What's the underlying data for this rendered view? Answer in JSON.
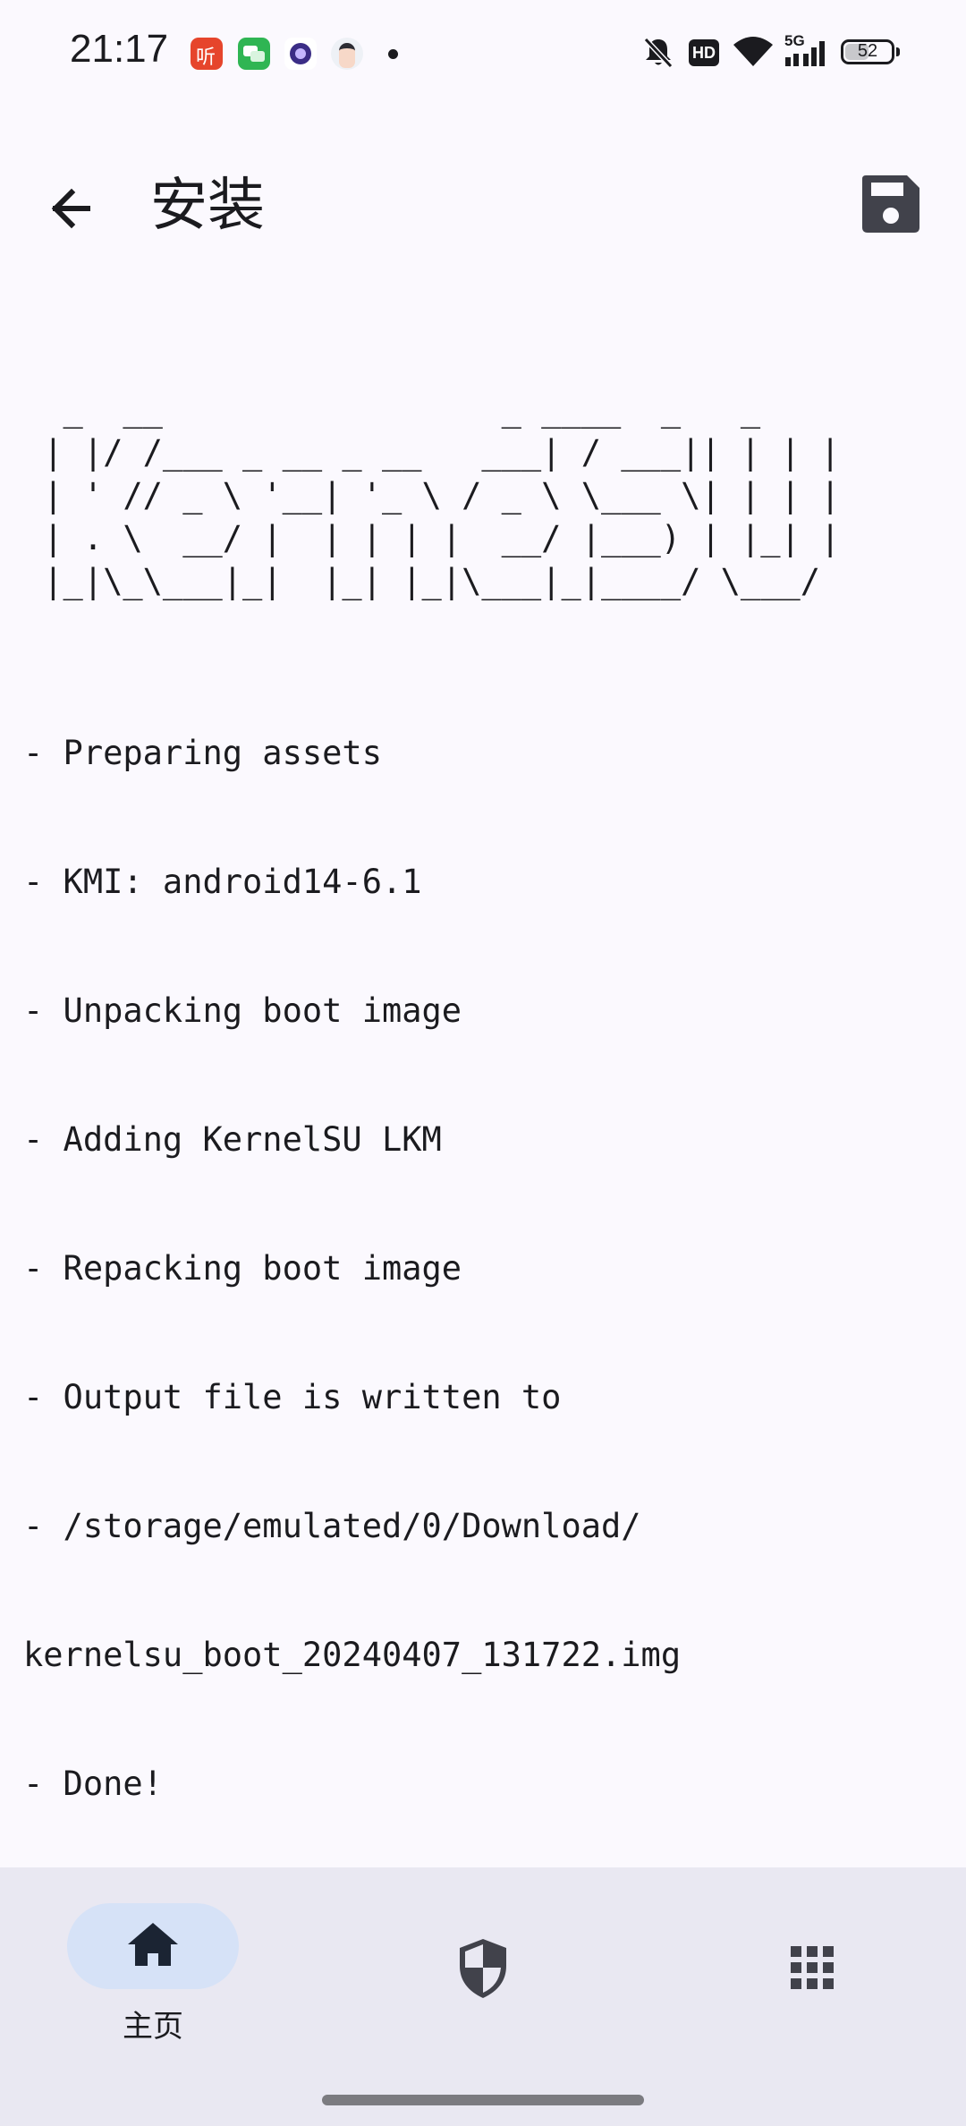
{
  "status_bar": {
    "time": "21:17",
    "notification_icons": [
      "ting-app-icon",
      "messages-app-icon",
      "browser-app-icon",
      "avatar-app-icon",
      "more-notifications-dot"
    ],
    "network_label": "5G",
    "hd_label": "HD",
    "battery_level": "52"
  },
  "app_bar": {
    "title": "安装",
    "back_icon": "arrow-back-icon",
    "save_icon": "save-icon"
  },
  "log": {
    "banner": "  _  __                 _ ____  _   _ \n | |/ /___ _ __ _ __   ___| / ___|| | | |\n | ' // _ \\ '__| '_ \\ / _ \\ \\___ \\| | | |\n | . \\  __/ |  | | | |  __/ |___) | |_| |\n |_|\\_\\___|_|  |_| |_|\\___|_|____/ \\___/",
    "lines": [
      "- Preparing assets",
      "- KMI: android14-6.1",
      "- Unpacking boot image",
      "- Adding KernelSU LKM",
      "- Repacking boot image",
      "- Output file is written to",
      "- /storage/emulated/0/Download/",
      "kernelsu_boot_20240407_131722.img",
      "- Done!"
    ]
  },
  "bottom_nav": {
    "items": [
      {
        "label": "主页",
        "icon": "home-icon",
        "selected": true
      },
      {
        "label": "",
        "icon": "shield-icon",
        "selected": false
      },
      {
        "label": "",
        "icon": "apps-grid-icon",
        "selected": false
      }
    ]
  },
  "colors": {
    "background": "#fbf9fe",
    "nav_background": "#e9e8f2",
    "nav_indicator": "#d6e2f7",
    "text": "#1b1b1f",
    "icon": "#41424b"
  }
}
